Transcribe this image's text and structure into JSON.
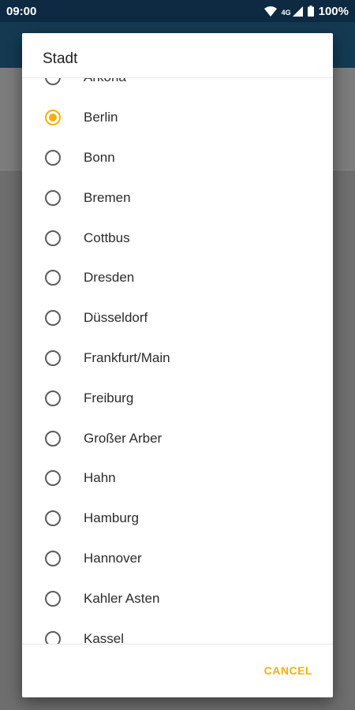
{
  "status_bar": {
    "time": "09:00",
    "network": "4G",
    "battery": "100%",
    "icons": [
      "wifi-icon",
      "cell-signal-icon",
      "battery-icon"
    ]
  },
  "dialog": {
    "title": "Stadt",
    "options": [
      {
        "label": "Arkona",
        "selected": false
      },
      {
        "label": "Berlin",
        "selected": true
      },
      {
        "label": "Bonn",
        "selected": false
      },
      {
        "label": "Bremen",
        "selected": false
      },
      {
        "label": "Cottbus",
        "selected": false
      },
      {
        "label": "Dresden",
        "selected": false
      },
      {
        "label": "Düsseldorf",
        "selected": false
      },
      {
        "label": "Frankfurt/Main",
        "selected": false
      },
      {
        "label": "Freiburg",
        "selected": false
      },
      {
        "label": "Großer Arber",
        "selected": false
      },
      {
        "label": "Hahn",
        "selected": false
      },
      {
        "label": "Hamburg",
        "selected": false
      },
      {
        "label": "Hannover",
        "selected": false
      },
      {
        "label": "Kahler Asten",
        "selected": false
      },
      {
        "label": "Kassel",
        "selected": false
      }
    ],
    "cancel_label": "CANCEL"
  },
  "colors": {
    "accent": "#f4b10b",
    "status_bar": "#0d2a42",
    "scrim": "#6f6f6f"
  }
}
